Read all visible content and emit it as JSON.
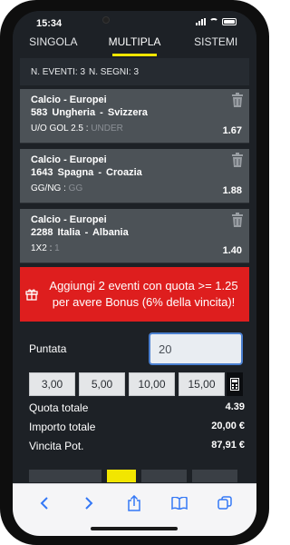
{
  "status_bar": {
    "time": "15:34"
  },
  "tabs": [
    {
      "label": "SINGOLA",
      "active": false
    },
    {
      "label": "MULTIPLA",
      "active": true
    },
    {
      "label": "SISTEMI",
      "active": false
    }
  ],
  "events_bar": {
    "eventi": "N. EVENTI: 3",
    "segni": "N. SEGNI: 3"
  },
  "bets": [
    {
      "competition": "Calcio - Europei",
      "code": "583",
      "match": "Ungheria  -  Svizzera",
      "market": "U/O GOL 2.5 : ",
      "selection": "UNDER",
      "odd": "1.67"
    },
    {
      "competition": "Calcio - Europei",
      "code": "1643",
      "match": "Spagna  -  Croazia",
      "market": "GG/NG : ",
      "selection": "GG",
      "odd": "1.88"
    },
    {
      "competition": "Calcio - Europei",
      "code": "2288",
      "match": "Italia  -  Albania",
      "market": "1X2 : ",
      "selection": "1",
      "odd": "1.40"
    }
  ],
  "bonus": {
    "text": "Aggiungi 2 eventi con quota >= 1.25 per avere Bonus (6% della vincita)!"
  },
  "stake": {
    "label": "Puntata",
    "value": "20"
  },
  "presets": [
    "3,00",
    "5,00",
    "10,00",
    "15,00"
  ],
  "summary": {
    "quota_label": "Quota totale",
    "quota_value": "4.39",
    "importo_label": "Importo totale",
    "importo_value": "20,00 €",
    "vincita_label": "Vincita Pot.",
    "vincita_value": "87,91 €"
  },
  "colors": {
    "accent": "#f2e600",
    "bonus_red": "#de1e1e",
    "card_bg": "#4c5257",
    "ios_blue": "#3478f6"
  }
}
